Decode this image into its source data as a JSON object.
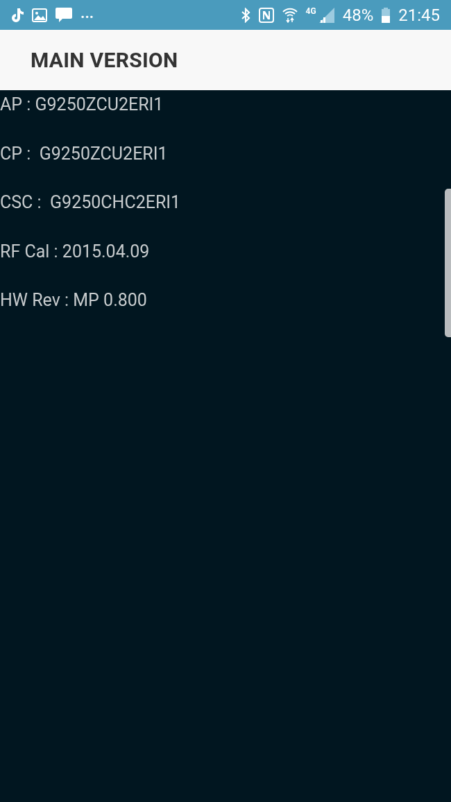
{
  "status_bar": {
    "more": "...",
    "network": "4G",
    "battery": "48%",
    "time": "21:45"
  },
  "app_bar": {
    "title": "MAIN VERSION"
  },
  "lines": [
    {
      "text": "AP : G9250ZCU2ERI1"
    },
    {
      "text": "CP :  G9250ZCU2ERI1"
    },
    {
      "text": "CSC :  G9250CHC2ERI1"
    },
    {
      "text": "RF Cal : 2015.04.09"
    },
    {
      "text": "HW Rev : MP 0.800"
    }
  ]
}
